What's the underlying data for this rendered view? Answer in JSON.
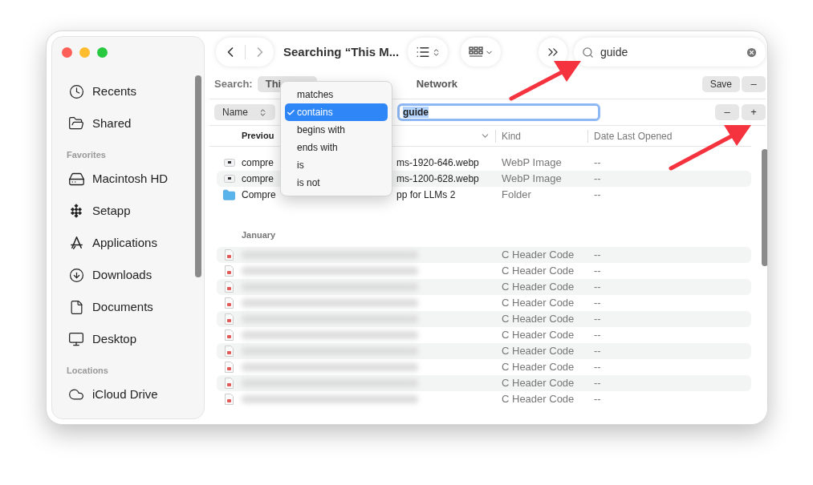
{
  "window": {
    "title": "Searching “This M..."
  },
  "search_field": {
    "value": "guide"
  },
  "sidebar": {
    "items": [
      {
        "kind": "item",
        "label": "Recents"
      },
      {
        "kind": "item",
        "label": "Shared"
      },
      {
        "kind": "heading",
        "label": "Favorites"
      },
      {
        "kind": "item",
        "label": "Macintosh HD"
      },
      {
        "kind": "item",
        "label": "Setapp"
      },
      {
        "kind": "item",
        "label": "Applications"
      },
      {
        "kind": "item",
        "label": "Downloads"
      },
      {
        "kind": "item",
        "label": "Documents"
      },
      {
        "kind": "item",
        "label": "Desktop"
      },
      {
        "kind": "heading",
        "label": "Locations"
      },
      {
        "kind": "item",
        "label": "iCloud Drive"
      }
    ]
  },
  "scope": {
    "label": "Search:",
    "options": [
      {
        "label": "Thi",
        "selected": true
      },
      {
        "label": "Network",
        "selected": false
      }
    ],
    "save": "Save",
    "remove": "–"
  },
  "criteria": {
    "attribute": "Name",
    "value": "guide",
    "remove": "–",
    "add": "+",
    "operators": [
      {
        "label": "matches",
        "selected": false
      },
      {
        "label": "contains",
        "selected": true
      },
      {
        "label": "begins with",
        "selected": false
      },
      {
        "label": "ends with",
        "selected": false
      },
      {
        "label": "is",
        "selected": false
      },
      {
        "label": "is not",
        "selected": false
      }
    ]
  },
  "columns": [
    "Previou",
    "Kind",
    "Date Last Opened"
  ],
  "files": [
    {
      "kind": "image",
      "name_start": "compre",
      "name_end": "ms-1920-646.webp",
      "kind_text": "WebP Image",
      "date": "--"
    },
    {
      "kind": "image",
      "name_start": "compre",
      "name_end": "ms-1200-628.webp",
      "kind_text": "WebP Image",
      "date": "--"
    },
    {
      "kind": "folder",
      "name_start": "Compre",
      "name_end": "pp for LLMs 2",
      "kind_text": "Folder",
      "date": "--"
    }
  ],
  "groups": [
    {
      "title": "January",
      "rows": [
        {
          "kind": "header",
          "kind_text": "C Header Code",
          "date": "--"
        },
        {
          "kind": "header",
          "kind_text": "C Header Code",
          "date": "--"
        },
        {
          "kind": "header",
          "kind_text": "C Header Code",
          "date": "--"
        },
        {
          "kind": "header",
          "kind_text": "C Header Code",
          "date": "--"
        },
        {
          "kind": "header",
          "kind_text": "C Header Code",
          "date": "--"
        },
        {
          "kind": "header",
          "kind_text": "C Header Code",
          "date": "--"
        },
        {
          "kind": "header",
          "kind_text": "C Header Code",
          "date": "--"
        },
        {
          "kind": "header",
          "kind_text": "C Header Code",
          "date": "--"
        },
        {
          "kind": "header",
          "kind_text": "C Header Code",
          "date": "--"
        },
        {
          "kind": "header",
          "kind_text": "C Header Code",
          "date": "--"
        }
      ]
    }
  ]
}
